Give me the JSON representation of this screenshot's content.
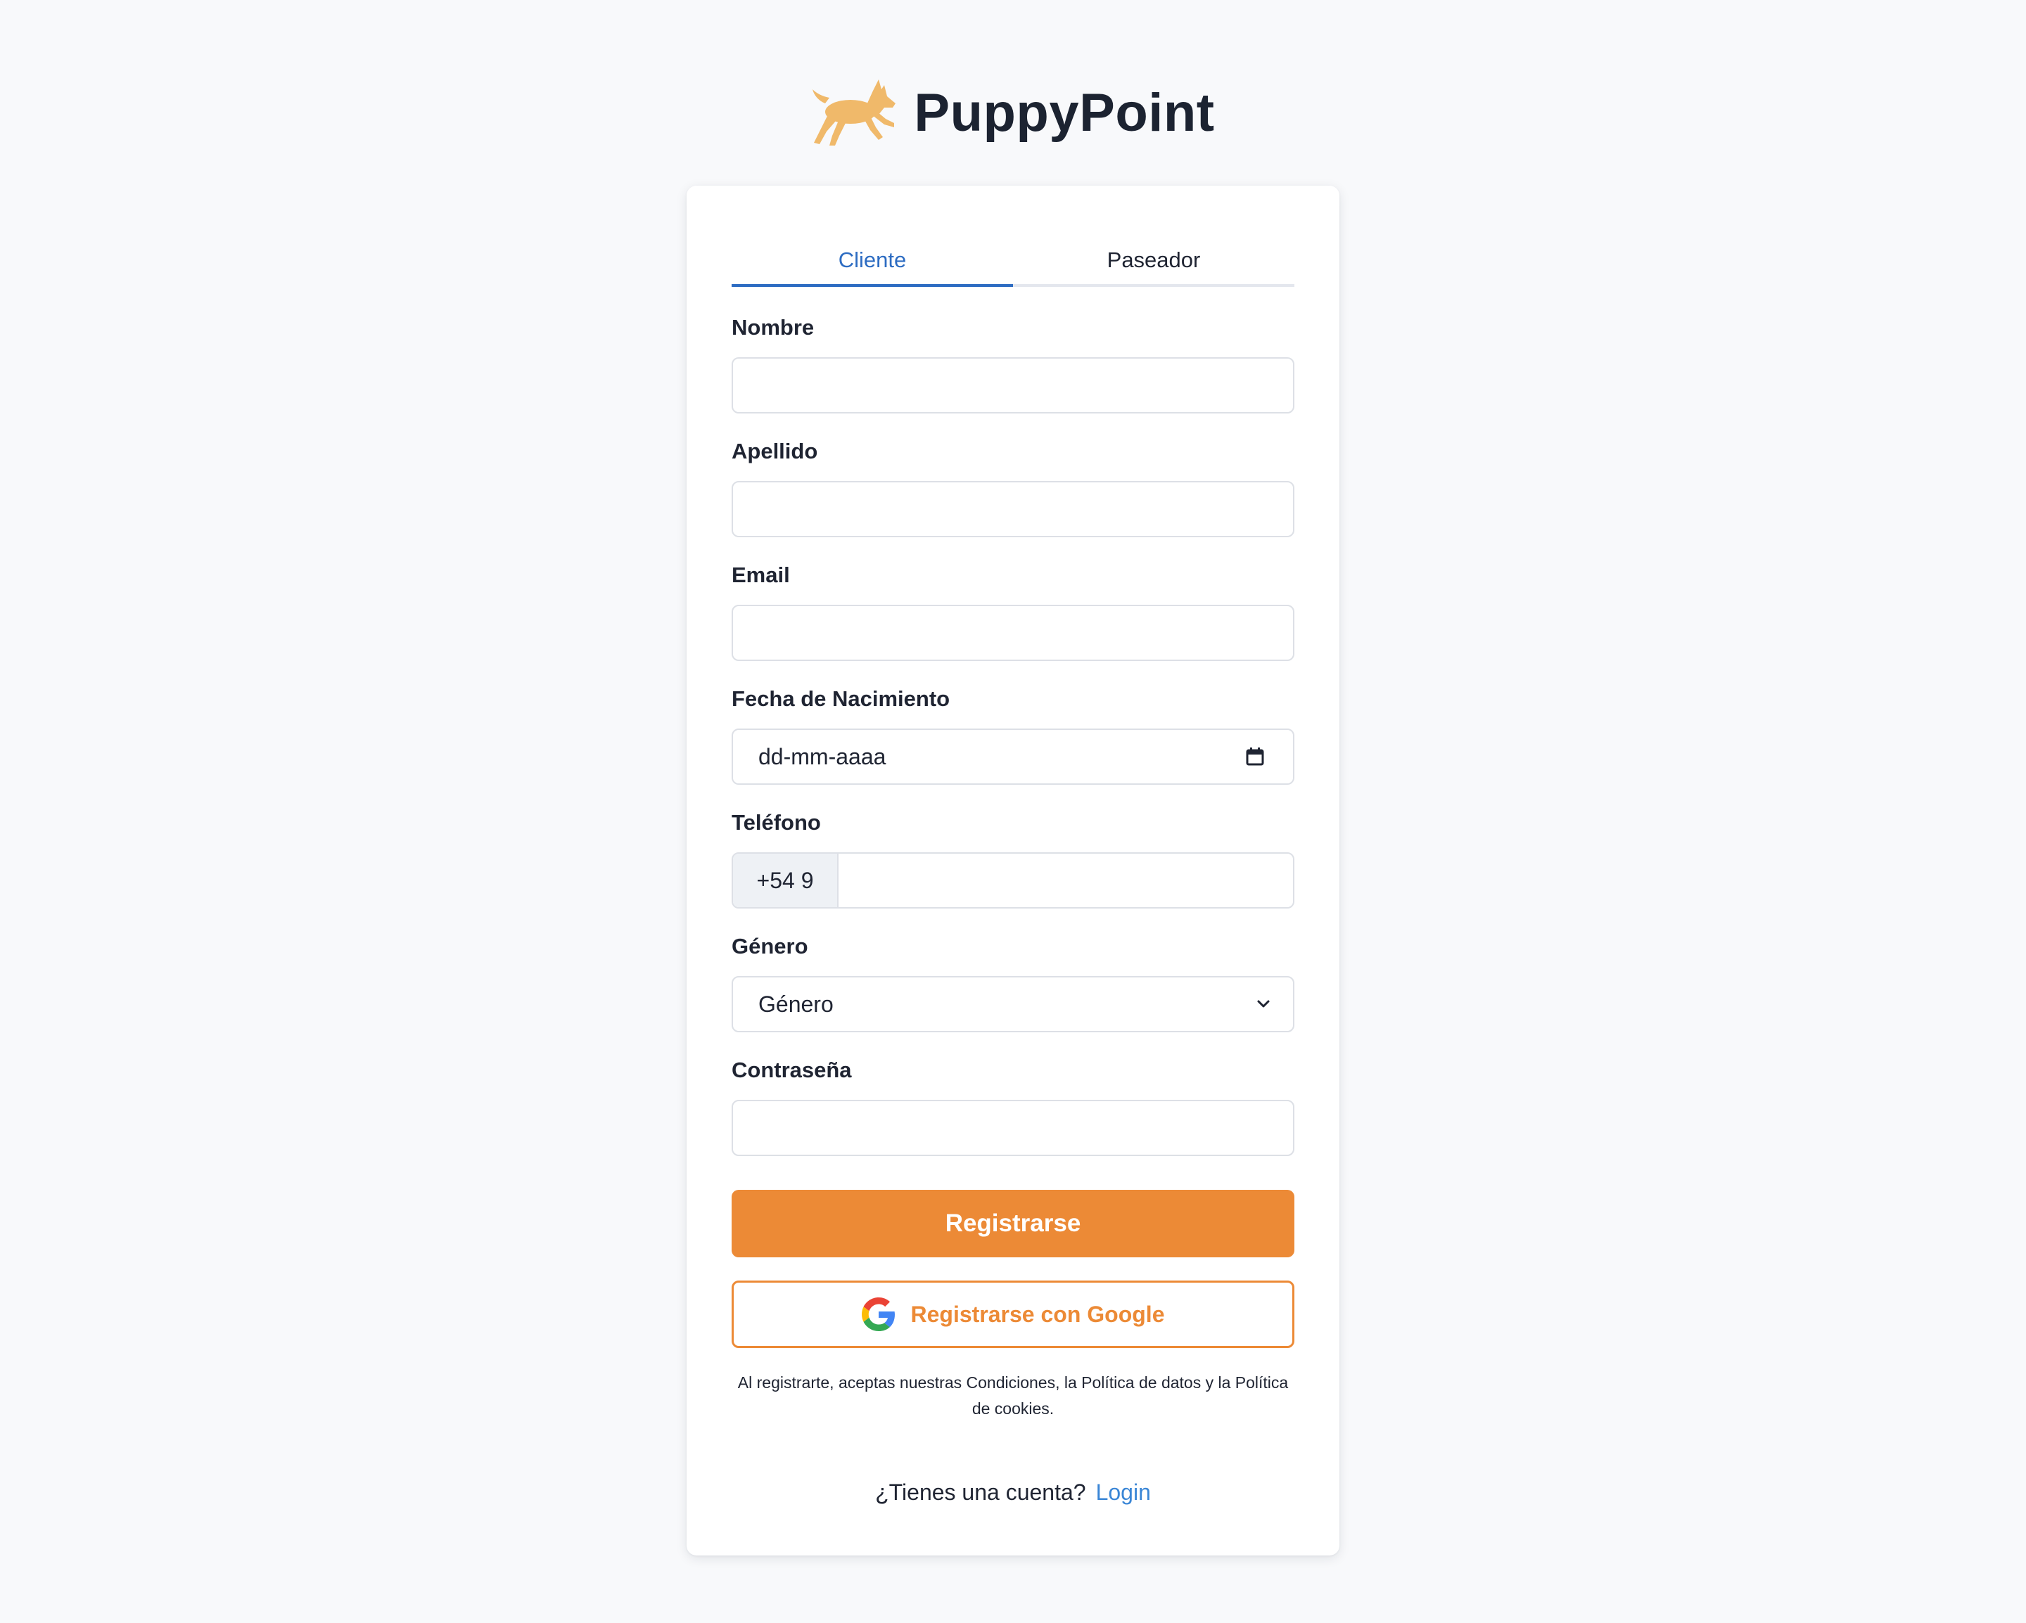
{
  "brand": {
    "name": "PuppyPoint",
    "logo_icon": "dog-icon",
    "logo_color": "#f0b96a"
  },
  "tabs": [
    {
      "label": "Cliente",
      "active": true
    },
    {
      "label": "Paseador",
      "active": false
    }
  ],
  "form": {
    "nombre": {
      "label": "Nombre",
      "value": ""
    },
    "apellido": {
      "label": "Apellido",
      "value": ""
    },
    "email": {
      "label": "Email",
      "value": ""
    },
    "fecha": {
      "label": "Fecha de Nacimiento",
      "placeholder": "dd-mm-aaaa",
      "icon": "calendar-icon"
    },
    "telefono": {
      "label": "Teléfono",
      "prefix": "+54 9",
      "value": ""
    },
    "genero": {
      "label": "Género",
      "selected": "Género",
      "icon": "chevron-down-icon"
    },
    "password": {
      "label": "Contraseña",
      "value": ""
    }
  },
  "actions": {
    "register_label": "Registrarse",
    "google_label": "Registrarse con Google",
    "google_icon": "google-icon"
  },
  "terms_text": "Al registrarte, aceptas nuestras Condiciones, la Política de datos y la Política de cookies.",
  "login": {
    "prompt": "¿Tienes una cuenta?",
    "link_label": "Login"
  },
  "colors": {
    "accent": "#ec8a36",
    "tab_active": "#2d6cc2",
    "link": "#3a86d6",
    "background": "#f8f9fb"
  }
}
